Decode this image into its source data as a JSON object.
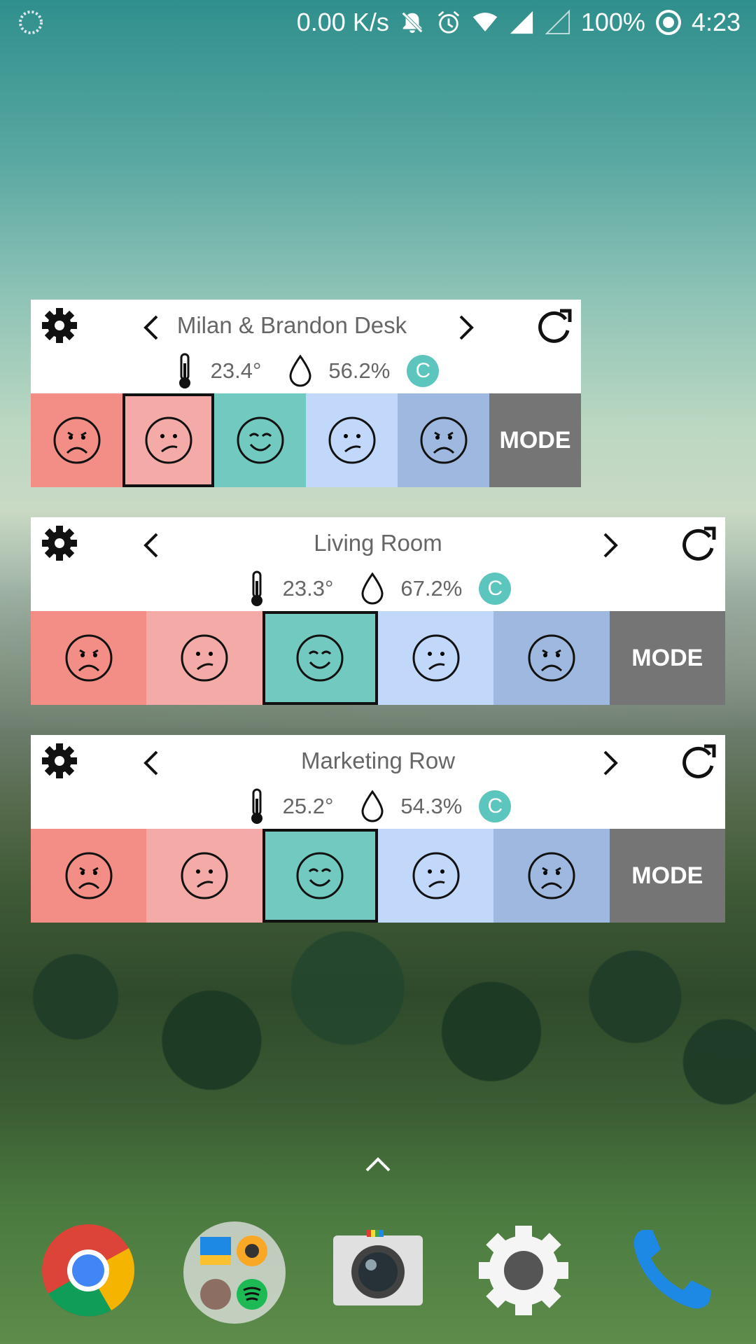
{
  "statusbar": {
    "speed": "0.00 K/s",
    "battery": "100%",
    "time": "4:23",
    "icons": [
      "loading-icon",
      "mute-icon",
      "alarm-icon",
      "wifi-icon",
      "signal-icon",
      "signal-empty-icon",
      "battery-saver-icon"
    ]
  },
  "widgets": [
    {
      "title": "Milan & Brandon Desk",
      "temperature": "23.4°",
      "humidity": "56.2%",
      "unit": "C",
      "selected": 1,
      "mode_label": "MODE"
    },
    {
      "title": "Living Room",
      "temperature": "23.3°",
      "humidity": "67.2%",
      "unit": "C",
      "selected": 2,
      "mode_label": "MODE"
    },
    {
      "title": "Marketing Row",
      "temperature": "25.2°",
      "humidity": "54.3%",
      "unit": "C",
      "selected": 2,
      "mode_label": "MODE"
    }
  ],
  "mood_colors": [
    "#f28e86",
    "#f4aaa7",
    "#72c9bf",
    "#c2d8fb",
    "#9fb8e0"
  ],
  "mode_color": "#757575",
  "dock": {
    "apps": [
      "chrome-icon",
      "folder-icon",
      "camera-icon",
      "settings-icon",
      "phone-icon"
    ]
  }
}
